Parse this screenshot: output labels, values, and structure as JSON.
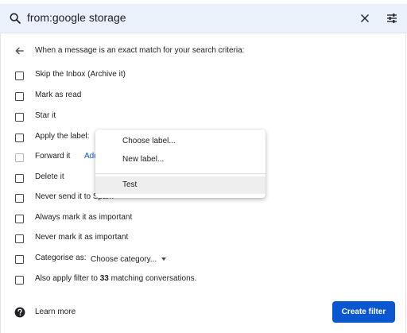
{
  "search": {
    "query": "from:google storage"
  },
  "criteria": {
    "header": "When a message is an exact match for your search criteria:"
  },
  "options": [
    {
      "label": "Skip the Inbox (Archive it)"
    },
    {
      "label": "Mark as read"
    },
    {
      "label": "Star it"
    },
    {
      "label": "Apply the label:"
    },
    {
      "label": "Forward it",
      "link": "Add"
    },
    {
      "label": "Delete it"
    },
    {
      "label": "Never send it to Spam"
    },
    {
      "label": "Always mark it as important"
    },
    {
      "label": "Never mark it as important"
    },
    {
      "label": "Categorise as:"
    },
    {
      "label_prefix": "Also apply filter to",
      "count": "33",
      "label_suffix": "matching conversations."
    }
  ],
  "category_select": {
    "value": "Choose category..."
  },
  "label_menu": {
    "items": [
      "Choose label...",
      "New label...",
      "Test"
    ]
  },
  "footer": {
    "learn_more": "Learn more",
    "create_filter": "Create filter"
  },
  "colors": {
    "accent": "#0b57d0",
    "search_bg": "#eaf1fb"
  },
  "icons": [
    "search-icon",
    "clear-icon",
    "tune-icon",
    "back-arrow-icon",
    "help-icon",
    "dropdown-caret-icon"
  ]
}
